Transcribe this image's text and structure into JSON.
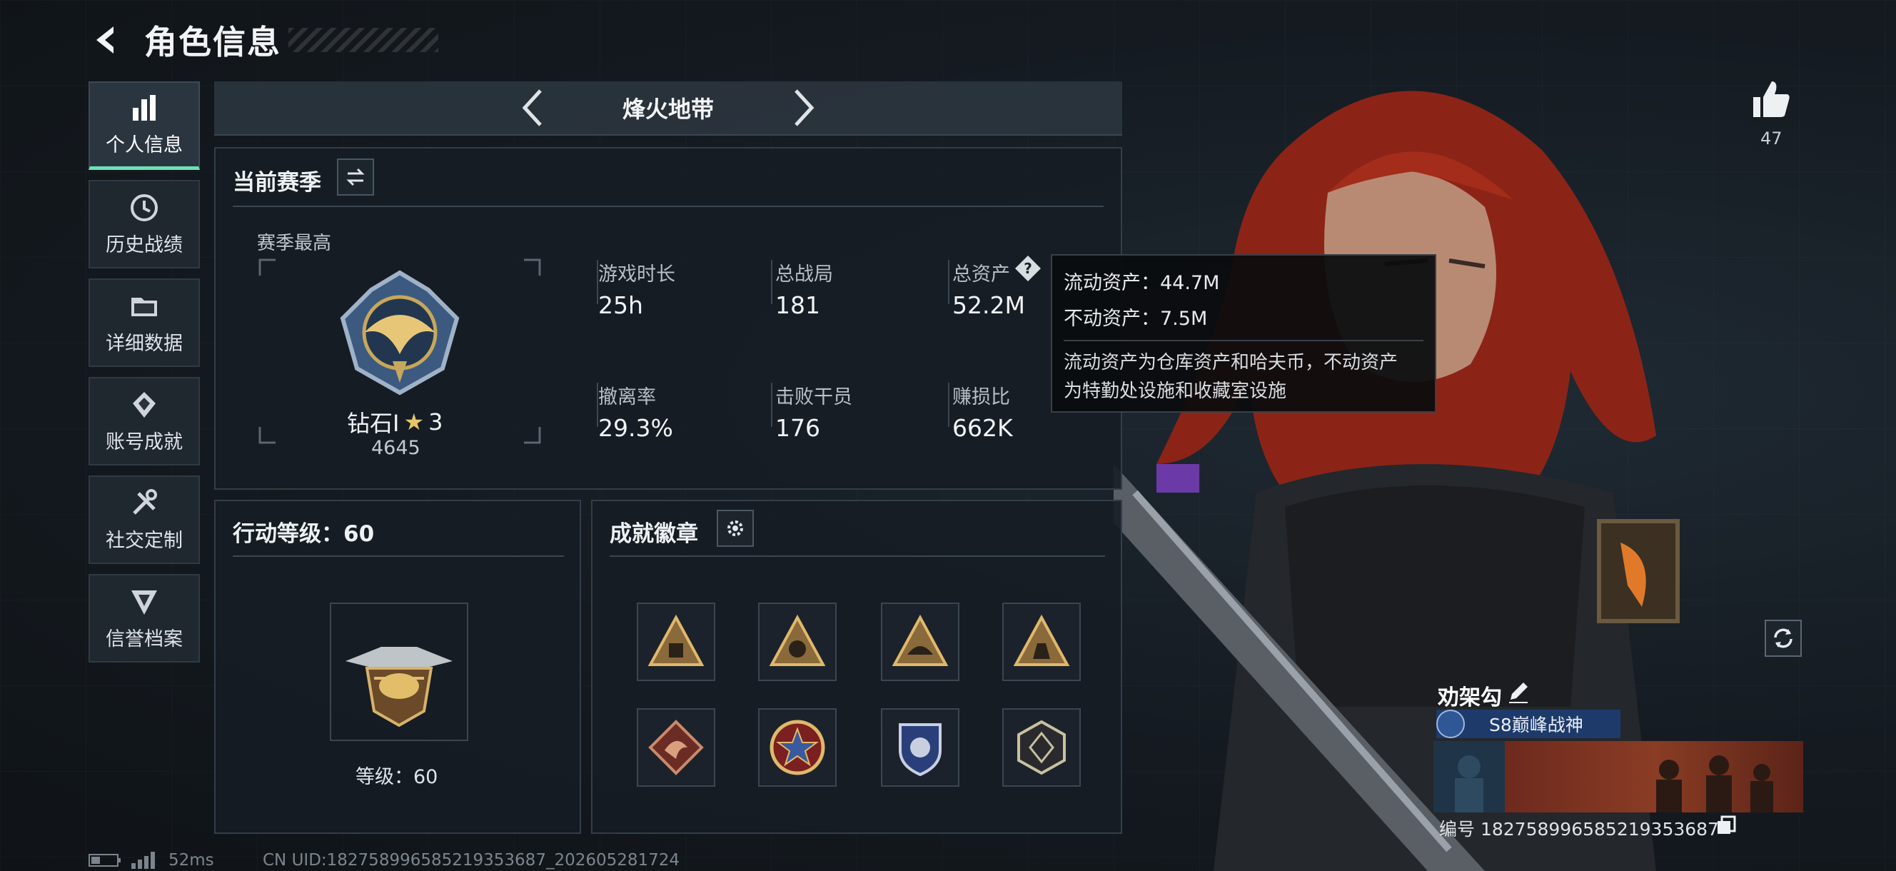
{
  "header": {
    "title": "角色信息"
  },
  "sidebar": {
    "items": [
      {
        "label": "个人信息",
        "icon": "bar-chart-icon",
        "active": true
      },
      {
        "label": "历史战绩",
        "icon": "clock-icon",
        "active": false
      },
      {
        "label": "详细数据",
        "icon": "folder-icon",
        "active": false
      },
      {
        "label": "账号成就",
        "icon": "medal-icon",
        "active": false
      },
      {
        "label": "社交定制",
        "icon": "tools-icon",
        "active": false
      },
      {
        "label": "信誉档案",
        "icon": "shield-icon",
        "active": false
      }
    ]
  },
  "mode": {
    "name": "烽火地带"
  },
  "season": {
    "title": "当前赛季",
    "best_label": "赛季最高",
    "rank_name": "钻石I",
    "rank_stars": "3",
    "rank_score": "4645",
    "stats": [
      {
        "label": "游戏时长",
        "value": "25h"
      },
      {
        "label": "总战局",
        "value": "181"
      },
      {
        "label": "总资产",
        "value": "52.2M"
      },
      {
        "label": "撤离率",
        "value": "29.3%"
      },
      {
        "label": "击败干员",
        "value": "176"
      },
      {
        "label": "赚损比",
        "value": "662K"
      }
    ]
  },
  "tooltip": {
    "liquid": "流动资产：44.7M",
    "fixed": "不动资产：7.5M",
    "desc_1": "流动资产为仓库资产和哈夫币，不动资产",
    "desc_2": "为特勤处设施和收藏室设施"
  },
  "level": {
    "title": "行动等级：60",
    "label": "等级：60"
  },
  "badges": {
    "title": "成就徽章",
    "items": [
      "triangle-badge-icon",
      "triangle-badge-icon",
      "triangle-badge-icon",
      "triangle-badge-icon",
      "dragon-badge-icon",
      "star-badge-icon",
      "shield-badge-icon",
      "hexagon-badge-icon"
    ]
  },
  "profile": {
    "likes": "47",
    "name": "劝架勾",
    "title_tag": "S8巅峰战神",
    "uid_line": "编号 182758996585219353687"
  },
  "status": {
    "ping": "52ms",
    "cn_uid": "CN UID:182758996585219353687_202605281724"
  },
  "colors": {
    "accent": "#6fe0b8",
    "panel": "#161d24",
    "tag": "#1e3a6a"
  }
}
